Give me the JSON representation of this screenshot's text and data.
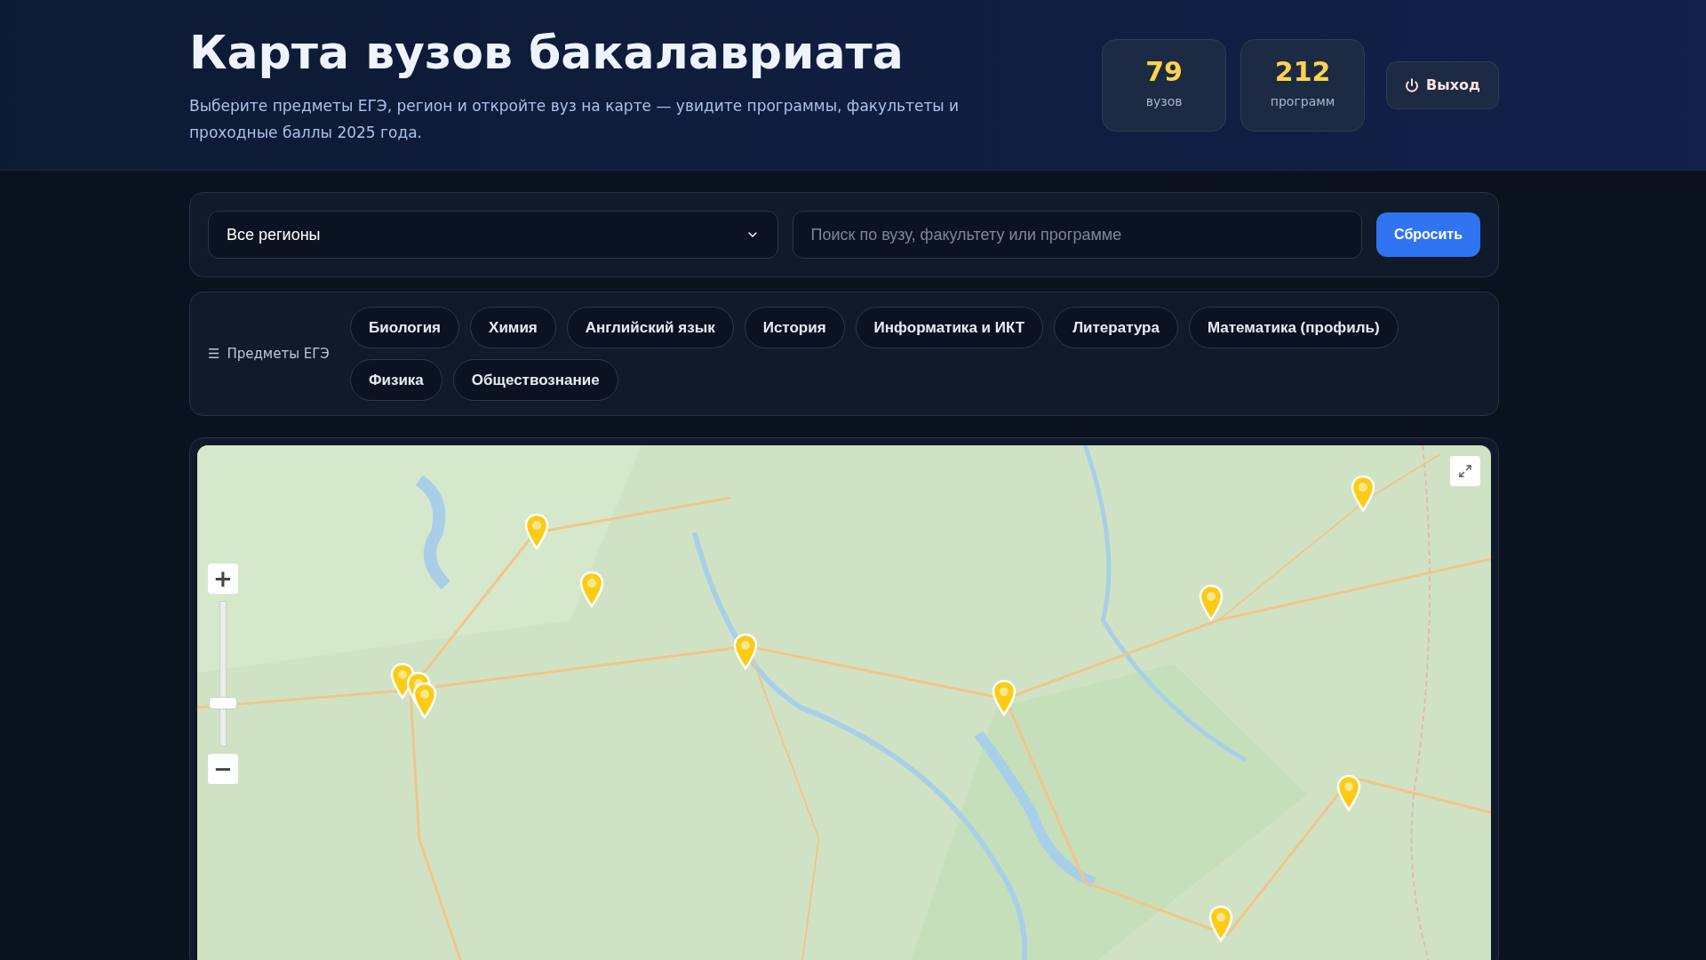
{
  "header": {
    "title": "Карта вузов бакалавриата",
    "subtitle": "Выберите предметы ЕГЭ, регион и откройте вуз на карте — увидите программы, факультеты и проходные баллы 2025 года.",
    "stats": [
      {
        "value": "79",
        "label": "вузов"
      },
      {
        "value": "212",
        "label": "программ"
      }
    ],
    "logout_button": "Выход"
  },
  "filters": {
    "region_select": "Все регионы",
    "search": {
      "placeholder": "Поиск по вузу, факультету или программе"
    },
    "reset_button": "Сбросить"
  },
  "subjects": {
    "icon": "☰",
    "label": "Предметы ЕГЭ",
    "chips": [
      {
        "label": "Биология",
        "selected": false
      },
      {
        "label": "Химия",
        "selected": false
      },
      {
        "label": "Английский язык",
        "selected": false
      },
      {
        "label": "История",
        "selected": false
      },
      {
        "label": "Информатика и ИКТ",
        "selected": false
      },
      {
        "label": "Литература",
        "selected": false
      },
      {
        "label": "Математика (профиль)",
        "selected": false
      },
      {
        "label": "Физика",
        "selected": false
      },
      {
        "label": "Обществознание",
        "selected": false
      }
    ]
  },
  "map": {
    "zoom_in": "+",
    "zoom_out": "−",
    "zoom": {
      "level": 0.3
    }
  }
}
